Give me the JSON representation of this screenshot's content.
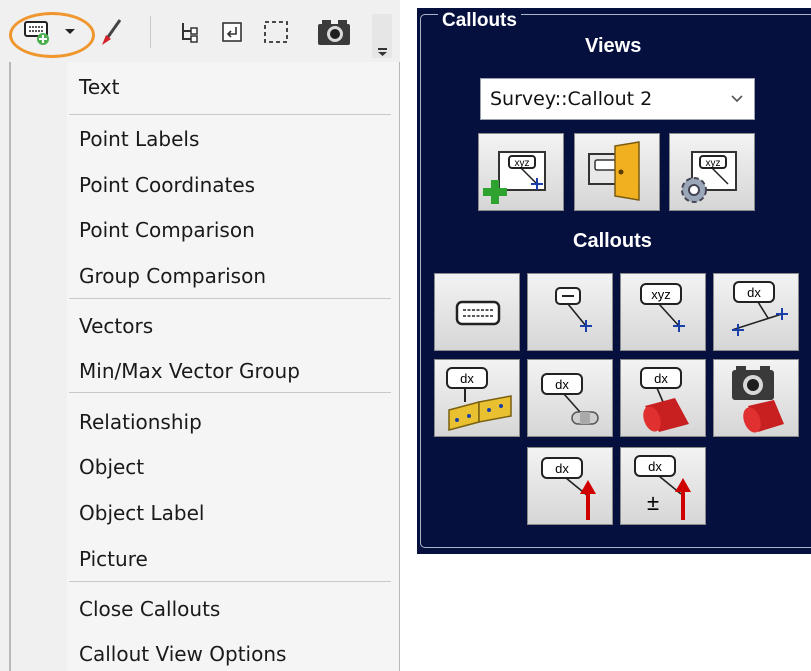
{
  "toolbar": {
    "icons": [
      "callout-add-icon",
      "dropdown-arrow-icon",
      "brush-icon",
      "hierarchy-icon",
      "insert-icon",
      "selection-box-icon",
      "camera-icon",
      "overflow-icon"
    ]
  },
  "menu": {
    "items": [
      "Text",
      "Point Labels",
      "Point Coordinates",
      "Point Comparison",
      "Group Comparison",
      "Vectors",
      "Min/Max Vector Group",
      "Relationship",
      "Object",
      "Object Label",
      "Picture",
      "Close Callouts",
      "Callout View Options"
    ]
  },
  "panel": {
    "title": "Callouts",
    "views_heading": "Views",
    "view_select_value": "Survey::Callout 2",
    "callouts_heading": "Callouts",
    "view_buttons": [
      "add-view-icon",
      "exit-view-icon",
      "view-settings-icon"
    ],
    "callout_buttons": [
      "text-callout-icon",
      "point-label-callout-icon",
      "coordinate-callout-icon",
      "point-comparison-callout-icon",
      "group-comparison-callout-icon",
      "relationship-callout-icon",
      "object-callout-icon",
      "picture-callout-icon",
      "vector-callout-icon",
      "minmax-vector-callout-icon"
    ]
  },
  "labels": {
    "dx": "dx",
    "xyz": "xyz",
    "pm": "±"
  },
  "colors": {
    "panel_bg": "#06103f",
    "highlight_ring": "#f0962e",
    "vector_red": "#d00000",
    "cylinder_red": "#c82020"
  }
}
